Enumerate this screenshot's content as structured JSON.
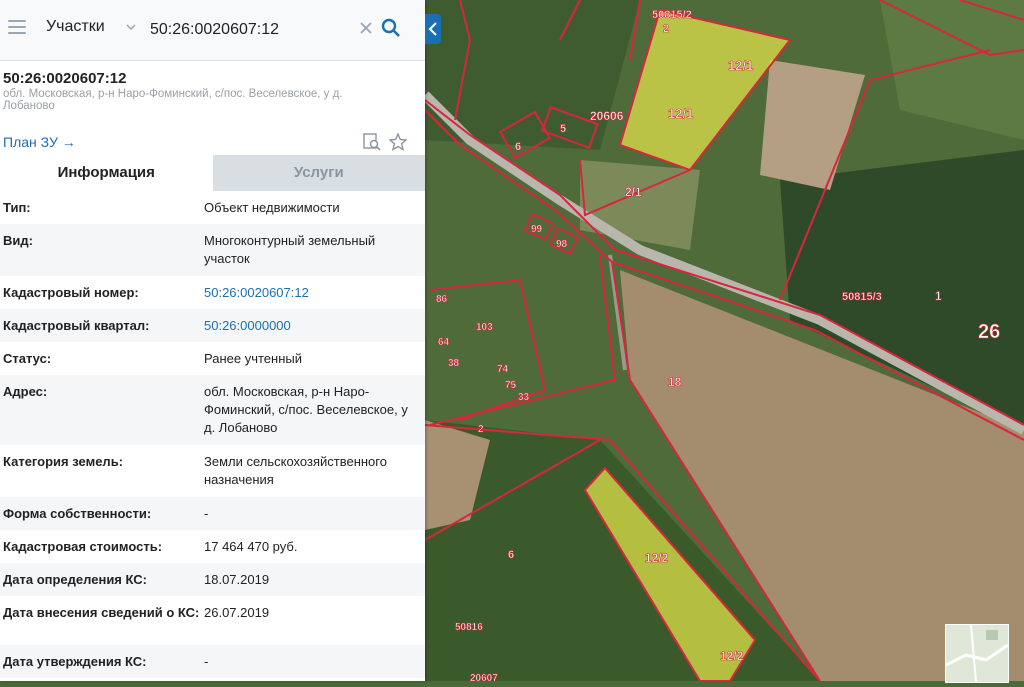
{
  "search": {
    "layer": "Участки",
    "query": "50:26:0020607:12"
  },
  "object": {
    "title": "50:26:0020607:12",
    "address": "обл. Московская, р-н Наро-Фоминский, с/пос. Веселевское, у д. Лобаново",
    "plan_link": "План ЗУ"
  },
  "tabs": [
    {
      "label": "Информация",
      "active": true
    },
    {
      "label": "Услуги",
      "active": false
    }
  ],
  "rows": [
    {
      "key": "Тип:",
      "value": "Объект недвижимости",
      "link": false
    },
    {
      "key": "Вид:",
      "value": "Многоконтурный земельный участок",
      "link": false
    },
    {
      "key": "Кадастровый номер:",
      "value": "50:26:0020607:12",
      "link": true
    },
    {
      "key": "Кадастровый квартал:",
      "value": "50:26:0000000",
      "link": true
    },
    {
      "key": "Статус:",
      "value": "Ранее учтенный",
      "link": false
    },
    {
      "key": "Адрес:",
      "value": "обл. Московская, р-н Наро-Фоминский, с/пос. Веселевское, у д. Лобаново",
      "link": false
    },
    {
      "key": "Категория земель:",
      "value": "Земли сельскохозяйственного назначения",
      "link": false
    },
    {
      "key": "Форма собственности:",
      "value": "-",
      "link": false
    },
    {
      "key": "Кадастровая стоимость:",
      "value": "17 464 470 руб.",
      "link": false
    },
    {
      "key": "Дата определения КС:",
      "value": "18.07.2019",
      "link": false
    },
    {
      "key": "Дата внесения сведений о КС:",
      "value": "26.07.2019",
      "link": false
    },
    {
      "key": "Дата утверждения КС:",
      "value": "-",
      "link": false
    }
  ],
  "map_labels": {
    "l1": "50815/2",
    "l2": "2",
    "l3": "12/1",
    "l4": "12/1",
    "l5": "20606",
    "l6": "5",
    "l7": "6",
    "l8": "2/1",
    "l9": "99",
    "l10": "98",
    "l11": "50815/3",
    "l12": "1",
    "l13": "26",
    "l14": "18",
    "l15": "86",
    "l16": "103",
    "l17": "64",
    "l18": "38",
    "l19": "74",
    "l20": "75",
    "l21": "33",
    "l22": "2",
    "l23": "12/2",
    "l24": "12/2",
    "l25": "6",
    "l26": "50816",
    "l27": "20607"
  },
  "colors": {
    "accent": "#1a6fb4",
    "boundary": "#d7263d",
    "highlight": "#e8e84a"
  }
}
